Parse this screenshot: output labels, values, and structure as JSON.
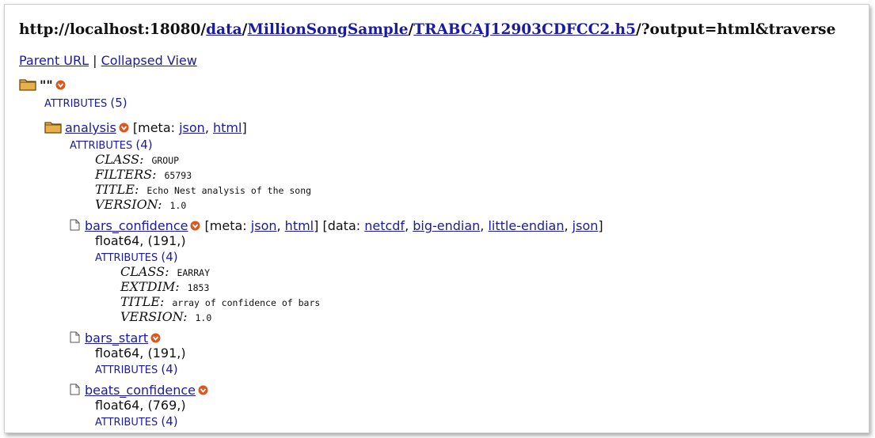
{
  "header": {
    "prefix": "http://localhost:18080/",
    "crumbs": [
      "data",
      "MillionSongSample",
      "TRABCAJ12903CDFCC2.h5"
    ],
    "sep": "/",
    "suffix": "/?output=html&traverse"
  },
  "nav": {
    "parent": "Parent URL",
    "sep": " | ",
    "collapsed": "Collapsed View"
  },
  "root": {
    "name": "\"\"",
    "attrs_label": "ATTRIBUTES",
    "attrs_count": "(5)"
  },
  "group": {
    "name": "analysis",
    "meta_open": " [meta: ",
    "json": "json",
    "comma": ", ",
    "html": "html",
    "close": "]",
    "attrs_label": "ATTRIBUTES",
    "attrs_count": "(4)",
    "attributes": [
      {
        "key": "CLASS:",
        "value": "GROUP"
      },
      {
        "key": "FILTERS:",
        "value": "65793"
      },
      {
        "key": "TITLE:",
        "value": "Echo Nest analysis of the song"
      },
      {
        "key": "VERSION:",
        "value": "1.0"
      }
    ]
  },
  "datasets": [
    {
      "name": "bars_confidence",
      "meta_open": " [meta: ",
      "json": "json",
      "comma": ", ",
      "html": "html",
      "close": "]",
      "data_open": " [data: ",
      "netcdf": "netcdf",
      "big": "big-endian",
      "little": "little-endian",
      "djson": "json",
      "dtype": "float64, (191,)",
      "attrs_label": "ATTRIBUTES",
      "attrs_count": "(4)",
      "attributes": [
        {
          "key": "CLASS:",
          "value": "EARRAY"
        },
        {
          "key": "EXTDIM:",
          "value": "1853"
        },
        {
          "key": "TITLE:",
          "value": "array of confidence of bars"
        },
        {
          "key": "VERSION:",
          "value": "1.0"
        }
      ]
    },
    {
      "name": "bars_start",
      "dtype": "float64, (191,)",
      "attrs_label": "ATTRIBUTES",
      "attrs_count": "(4)"
    },
    {
      "name": "beats_confidence",
      "dtype": "float64, (769,)",
      "attrs_label": "ATTRIBUTES",
      "attrs_count": "(4)"
    }
  ],
  "icons": {
    "folder": "folder-icon",
    "file": "file-icon",
    "expand": "expand-arrow-icon",
    "accent": "#e0561b",
    "link": "#1a1aa6"
  }
}
